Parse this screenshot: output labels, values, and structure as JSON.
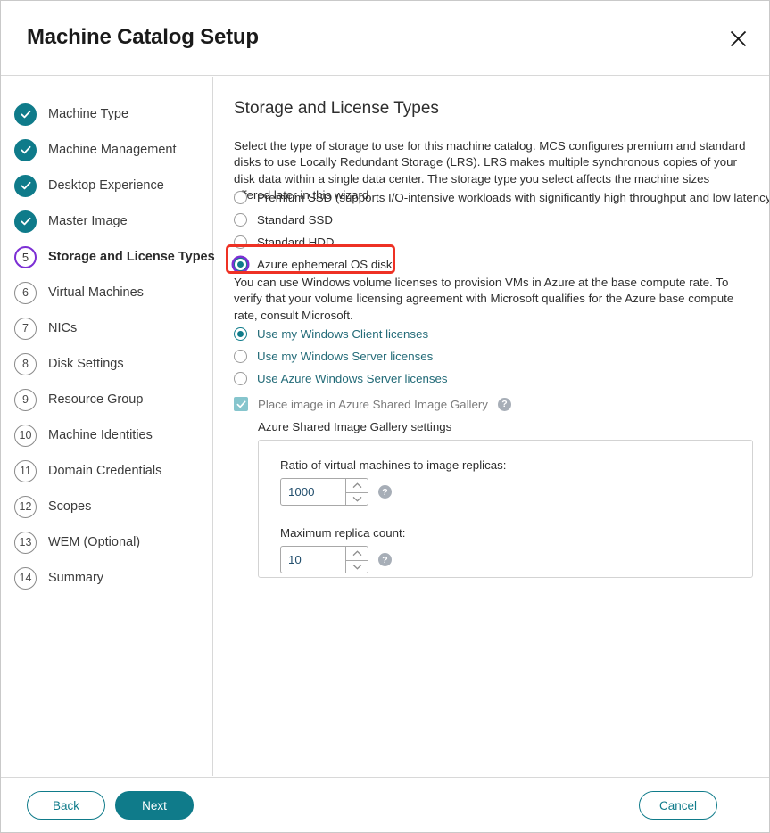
{
  "header": {
    "title": "Machine Catalog Setup",
    "close_icon": "close-icon"
  },
  "sidebar": {
    "steps": [
      {
        "number": "1",
        "label": "Machine Type",
        "state": "done"
      },
      {
        "number": "2",
        "label": "Machine Management",
        "state": "done"
      },
      {
        "number": "3",
        "label": "Desktop Experience",
        "state": "done"
      },
      {
        "number": "4",
        "label": "Master Image",
        "state": "done"
      },
      {
        "number": "5",
        "label": "Storage and License Types",
        "state": "current"
      },
      {
        "number": "6",
        "label": "Virtual Machines",
        "state": "pending"
      },
      {
        "number": "7",
        "label": "NICs",
        "state": "pending"
      },
      {
        "number": "8",
        "label": "Disk Settings",
        "state": "pending"
      },
      {
        "number": "9",
        "label": "Resource Group",
        "state": "pending"
      },
      {
        "number": "10",
        "label": "Machine Identities",
        "state": "pending"
      },
      {
        "number": "11",
        "label": "Domain Credentials",
        "state": "pending"
      },
      {
        "number": "12",
        "label": "Scopes",
        "state": "pending"
      },
      {
        "number": "13",
        "label": "WEM (Optional)",
        "state": "pending"
      },
      {
        "number": "14",
        "label": "Summary",
        "state": "pending"
      }
    ]
  },
  "main": {
    "section_title": "Storage and License Types",
    "storage_description": "Select the type of storage to use for this machine catalog. MCS configures premium and standard disks to use Locally Redundant Storage (LRS). LRS makes multiple synchronous copies of your disk data within a single data center. The storage type you select affects the machine sizes offered later in this wizard.",
    "storage_options": [
      {
        "label": "Premium SSD (supports I/O-intensive workloads with significantly high throughput and low latency)",
        "selected": false
      },
      {
        "label": "Standard SSD",
        "selected": false
      },
      {
        "label": "Standard HDD",
        "selected": false
      },
      {
        "label": "Azure ephemeral OS disk",
        "selected": true,
        "highlighted": true
      }
    ],
    "license_description": "You can use Windows volume licenses to provision VMs in Azure at the base compute rate. To verify that your volume licensing agreement with Microsoft qualifies for the Azure base compute rate, consult Microsoft.",
    "license_options": [
      {
        "label": "Use my Windows Client licenses",
        "selected": true
      },
      {
        "label": "Use my Windows Server licenses",
        "selected": false
      },
      {
        "label": "Use Azure Windows Server licenses",
        "selected": false
      }
    ],
    "gallery": {
      "checkbox_label": "Place image in Azure Shared Image Gallery",
      "checkbox_checked": true,
      "checkbox_disabled": true,
      "help_glyph": "?",
      "settings_heading": "Azure Shared Image Gallery settings",
      "fields": [
        {
          "label": "Ratio of virtual machines to image replicas:",
          "value": "1000",
          "help_glyph": "?"
        },
        {
          "label": "Maximum replica count:",
          "value": "10",
          "help_glyph": "?"
        }
      ]
    }
  },
  "footer": {
    "back_label": "Back",
    "next_label": "Next",
    "cancel_label": "Cancel"
  },
  "colors": {
    "accent_teal": "#0f7b8a",
    "current_step_purple": "#7c2fd4",
    "highlight_red": "#ee3124",
    "disabled_check": "#86c5cd",
    "license_text_teal": "#236b78"
  }
}
